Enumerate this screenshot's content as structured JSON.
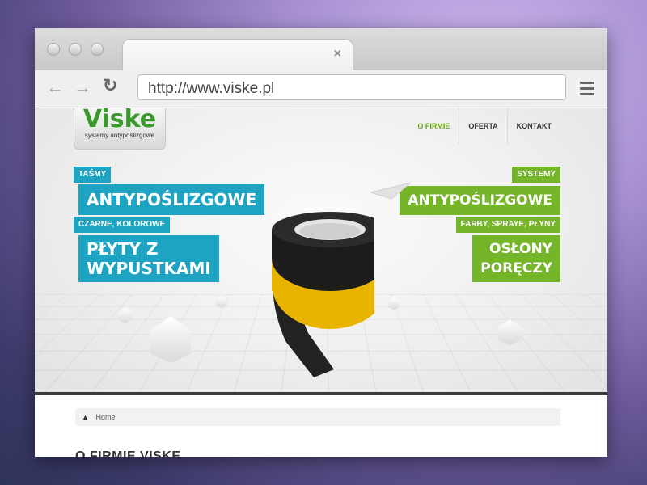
{
  "browser": {
    "tab_close": "×",
    "address": "http://www.viske.pl",
    "back_icon": "←",
    "forward_icon": "→",
    "reload_icon": "↻"
  },
  "logo": {
    "name": "Viske",
    "tagline": "systemy antypoślizgowe"
  },
  "nav": {
    "items": [
      {
        "label": "O FIRMIE",
        "active": true
      },
      {
        "label": "OFERTA",
        "active": false
      },
      {
        "label": "KONTAKT",
        "active": false
      }
    ]
  },
  "hero": {
    "left": {
      "small1": "TAŚMY",
      "big1": "ANTYPOŚLIZGOWE",
      "small2": "CZARNE, KOLOROWE",
      "big2_line1": "PŁYTY Z",
      "big2_line2": "WYPUSTKAMI"
    },
    "right": {
      "small1": "SYSTEMY",
      "big1": "ANTYPOŚLIZGOWE",
      "small2": "FARBY, SPRAYE, PŁYNY",
      "big2_line1": "OSŁONY",
      "big2_line2": "PORĘCZY"
    }
  },
  "breadcrumb": {
    "home": "Home"
  },
  "content": {
    "title": "O FIRMIE VISKE"
  },
  "colors": {
    "blue": "#1ea4c2",
    "green": "#75b52a",
    "logo_green": "#3a9a2c"
  }
}
